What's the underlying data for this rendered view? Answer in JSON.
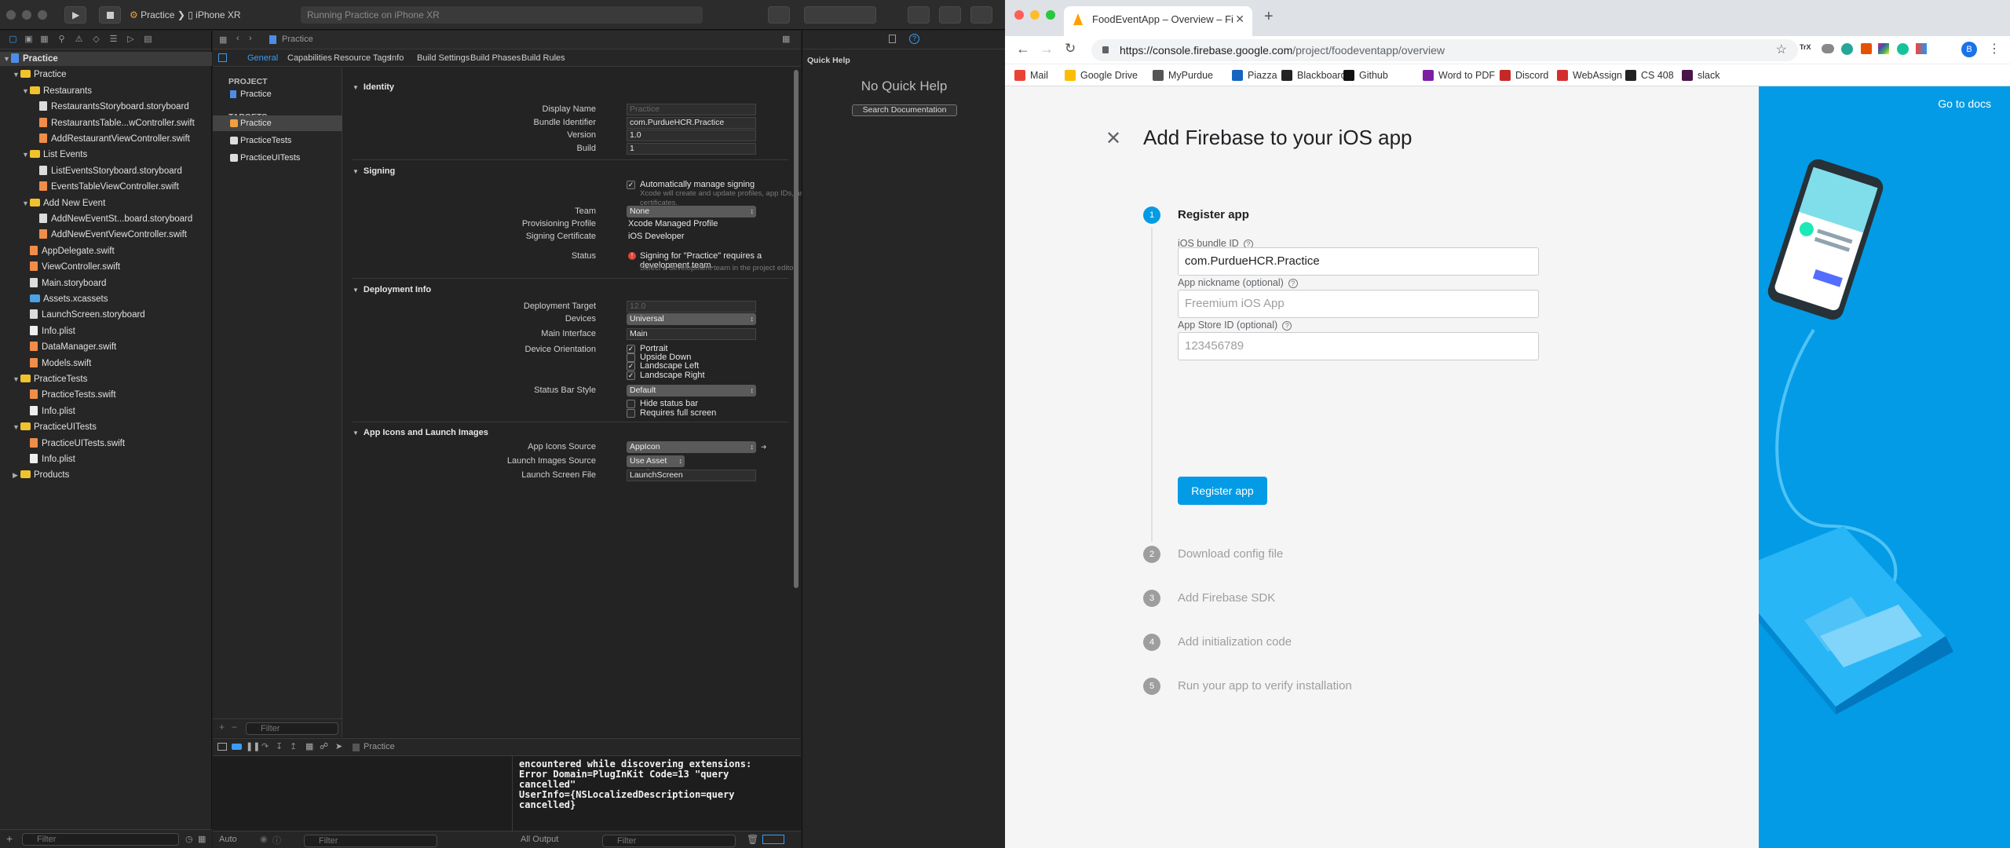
{
  "xcode": {
    "toolbar": {
      "scheme_name": "Practice",
      "device": "iPhone XR",
      "activity": "Running Practice on iPhone XR"
    },
    "navigator": {
      "tree": [
        {
          "label": "Practice",
          "kind": "proj",
          "bold": true
        },
        {
          "label": "Practice",
          "kind": "folder"
        },
        {
          "label": "Restaurants",
          "kind": "folder"
        },
        {
          "label": "RestaurantsStoryboard.storyboard",
          "kind": "sb"
        },
        {
          "label": "RestaurantsTable...wController.swift",
          "kind": "sw"
        },
        {
          "label": "AddRestaurantViewController.swift",
          "kind": "sw"
        },
        {
          "label": "List Events",
          "kind": "folder"
        },
        {
          "label": "ListEventsStoryboard.storyboard",
          "kind": "sb"
        },
        {
          "label": "EventsTableViewController.swift",
          "kind": "sw"
        },
        {
          "label": "Add New Event",
          "kind": "folder"
        },
        {
          "label": "AddNewEventSt...board.storyboard",
          "kind": "sb"
        },
        {
          "label": "AddNewEventViewController.swift",
          "kind": "sw"
        },
        {
          "label": "AppDelegate.swift",
          "kind": "sw"
        },
        {
          "label": "ViewController.swift",
          "kind": "sw"
        },
        {
          "label": "Main.storyboard",
          "kind": "sb"
        },
        {
          "label": "Assets.xcassets",
          "kind": "blue"
        },
        {
          "label": "LaunchScreen.storyboard",
          "kind": "sb"
        },
        {
          "label": "Info.plist",
          "kind": "file"
        },
        {
          "label": "DataManager.swift",
          "kind": "sw"
        },
        {
          "label": "Models.swift",
          "kind": "sw"
        },
        {
          "label": "PracticeTests",
          "kind": "folder"
        },
        {
          "label": "PracticeTests.swift",
          "kind": "sw"
        },
        {
          "label": "Info.plist",
          "kind": "file"
        },
        {
          "label": "PracticeUITests",
          "kind": "folder"
        },
        {
          "label": "PracticeUITests.swift",
          "kind": "sw"
        },
        {
          "label": "Info.plist",
          "kind": "file"
        },
        {
          "label": "Products",
          "kind": "folder"
        }
      ],
      "filter_placeholder": "Filter"
    },
    "jumpbar": {
      "crumb": "Practice"
    },
    "tabs": [
      "General",
      "Capabilities",
      "Resource Tags",
      "Info",
      "Build Settings",
      "Build Phases",
      "Build Rules"
    ],
    "targets": {
      "project_header": "PROJECT",
      "project": "Practice",
      "targets_header": "TARGETS",
      "items": [
        "Practice",
        "PracticeTests",
        "PracticeUITests"
      ],
      "filter_placeholder": "Filter"
    },
    "identity": {
      "title": "Identity",
      "display_name_label": "Display Name",
      "display_name_placeholder": "Practice",
      "bundle_label": "Bundle Identifier",
      "bundle": "com.PurdueHCR.Practice",
      "version_label": "Version",
      "version": "1.0",
      "build_label": "Build",
      "build": "1"
    },
    "signing": {
      "title": "Signing",
      "auto_label": "Automatically manage signing",
      "auto_sub": "Xcode will create and update profiles, app IDs, and certificates.",
      "team_label": "Team",
      "team": "None",
      "profile_label": "Provisioning Profile",
      "profile": "Xcode Managed Profile",
      "cert_label": "Signing Certificate",
      "cert": "iOS Developer",
      "status_label": "Status",
      "status": "Signing for \"Practice\" requires a development team.",
      "status_sub": "Select a development team in the project editor."
    },
    "deployment": {
      "title": "Deployment Info",
      "target_label": "Deployment Target",
      "target": "12.0",
      "devices_label": "Devices",
      "devices": "Universal",
      "main_label": "Main Interface",
      "main": "Main",
      "orient_label": "Device Orientation",
      "orientations": [
        {
          "label": "Portrait",
          "checked": true
        },
        {
          "label": "Upside Down",
          "checked": false
        },
        {
          "label": "Landscape Left",
          "checked": true
        },
        {
          "label": "Landscape Right",
          "checked": true
        }
      ],
      "statusbar_label": "Status Bar Style",
      "statusbar": "Default",
      "hide_status": "Hide status bar",
      "full_screen": "Requires full screen"
    },
    "icons": {
      "title": "App Icons and Launch Images",
      "source_label": "App Icons Source",
      "source": "AppIcon",
      "launch_label": "Launch Images Source",
      "launch_btn": "Use Asset Catalog...",
      "screen_label": "Launch Screen File",
      "screen": "LaunchScreen"
    },
    "debug": {
      "target": "Practice",
      "console": "encountered while discovering extensions:\nError Domain=PlugInKit Code=13 \"query\ncancelled\"\nUserInfo={NSLocalizedDescription=query\ncancelled}",
      "auto": "Auto",
      "all_output": "All Output",
      "filter_placeholder": "Filter"
    },
    "inspector": {
      "title": "Quick Help",
      "no_help": "No Quick Help",
      "search_btn": "Search Documentation"
    }
  },
  "chrome": {
    "tab_title": "FoodEventApp – Overview – Fi",
    "url_host": "https://console.firebase.google.com",
    "url_path": "/project/foodeventapp/overview",
    "bookmarks": [
      "Mail",
      "Google Drive",
      "MyPurdue",
      "Piazza",
      "Blackboard",
      "Github",
      "Word to PDF",
      "Discord",
      "WebAssign",
      "CS 408",
      "slack"
    ],
    "profile_initial": "B"
  },
  "firebase": {
    "go_to_docs": "Go to docs",
    "title": "Add Firebase to your iOS app",
    "steps": [
      {
        "num": "1",
        "label": "Register app",
        "active": true
      },
      {
        "num": "2",
        "label": "Download config file",
        "active": false
      },
      {
        "num": "3",
        "label": "Add Firebase SDK",
        "active": false
      },
      {
        "num": "4",
        "label": "Add initialization code",
        "active": false
      },
      {
        "num": "5",
        "label": "Run your app to verify installation",
        "active": false
      }
    ],
    "bundle_label": "iOS bundle ID",
    "bundle_value": "com.PurdueHCR.Practice",
    "nickname_label": "App nickname (optional)",
    "nickname_placeholder": "Freemium iOS App",
    "appstore_label": "App Store ID (optional)",
    "appstore_placeholder": "123456789",
    "register_btn": "Register app",
    "colors": {
      "accent": "#039be5",
      "panel": "#039be5"
    }
  }
}
